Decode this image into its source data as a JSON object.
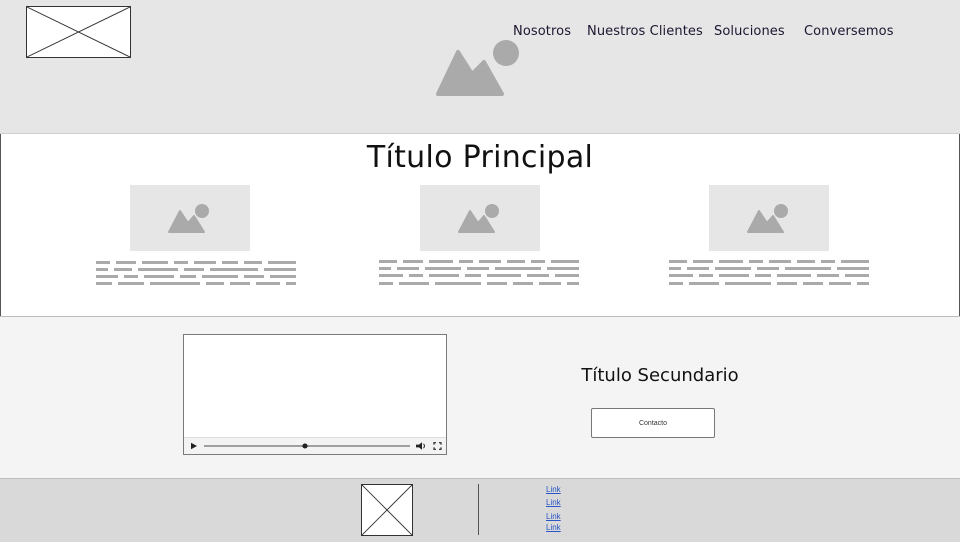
{
  "header": {
    "nav": [
      {
        "label": "Nosotros"
      },
      {
        "label": "Nuestros Clientes"
      },
      {
        "label": "Soluciones"
      },
      {
        "label": "Conversemos"
      }
    ]
  },
  "main": {
    "title": "Título Principal"
  },
  "section2": {
    "title": "Título Secundario",
    "button_label": "Contacto"
  },
  "footer": {
    "links": [
      {
        "label": "Link"
      },
      {
        "label": "Link"
      },
      {
        "label": "Link"
      },
      {
        "label": "Link"
      }
    ]
  },
  "colors": {
    "header_bg": "#e6e6e6",
    "placeholder_gray": "#aaaaaa",
    "section_bg": "#f4f4f4",
    "footer_bg": "#d9d9d9",
    "link": "#2a56c6"
  },
  "icons": [
    "image-placeholder-icon",
    "play-icon",
    "volume-icon",
    "fullscreen-icon"
  ]
}
